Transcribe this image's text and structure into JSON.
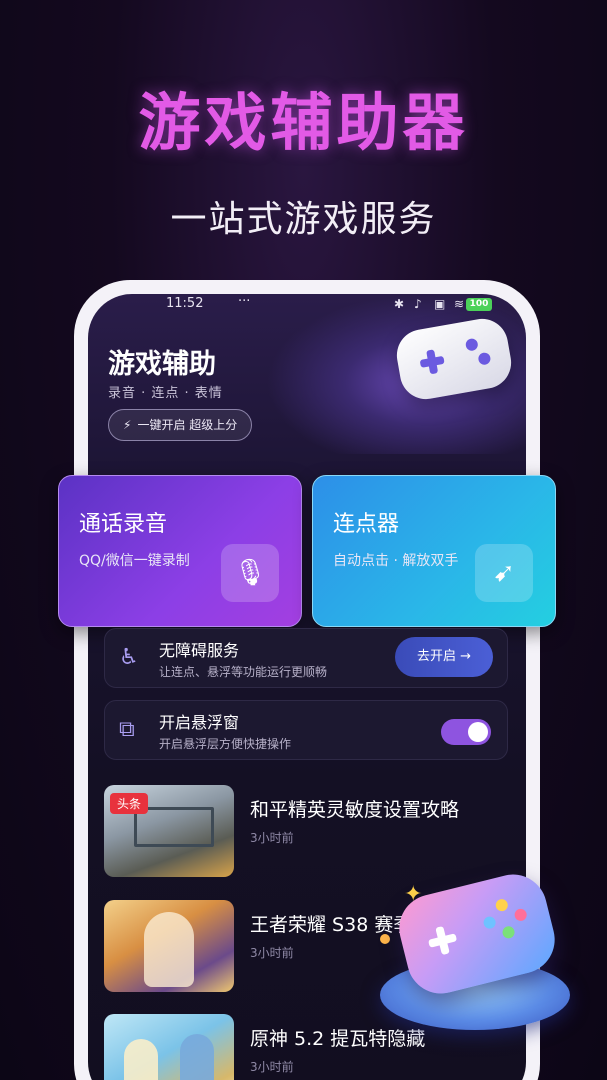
{
  "promo": {
    "headline": "游戏辅助器",
    "tagline": "一站式游戏服务"
  },
  "status_bar": {
    "time": "11:52",
    "dots": "···",
    "battery": "100"
  },
  "header": {
    "title": "游戏辅助",
    "subtitle": "录音 · 连点 · 表情",
    "quick_button": "一键开启 超级上分"
  },
  "feature_cards": [
    {
      "title": "通话录音",
      "subtitle": "QQ/微信一键录制",
      "icon": "microphone-icon"
    },
    {
      "title": "连点器",
      "subtitle": "自动点击 · 解放双手",
      "icon": "tap-cursor-icon"
    }
  ],
  "settings": {
    "accessibility": {
      "title": "无障碍服务",
      "subtitle": "让连点、悬浮等功能运行更顺畅",
      "button": "去开启 →",
      "icon": "wheelchair-icon"
    },
    "floating_window": {
      "title": "开启悬浮窗",
      "subtitle": "开启悬浮层方便快捷操作",
      "enabled": true,
      "icon": "popout-window-icon"
    }
  },
  "news": [
    {
      "title": "和平精英灵敏度设置攻略",
      "time": "3小时前",
      "tag": "头条"
    },
    {
      "title": "王者荣耀 S38 赛季",
      "time": "3小时前"
    },
    {
      "title": "原神 5.2 提瓦特隐藏",
      "time": "3小时前"
    }
  ],
  "colors": {
    "headline": "#e25ae6",
    "call_card": "#8c3fe6",
    "tap_card": "#2ab6e8",
    "toggle_on": "#8e54e0",
    "tag_red": "#e8323d"
  }
}
